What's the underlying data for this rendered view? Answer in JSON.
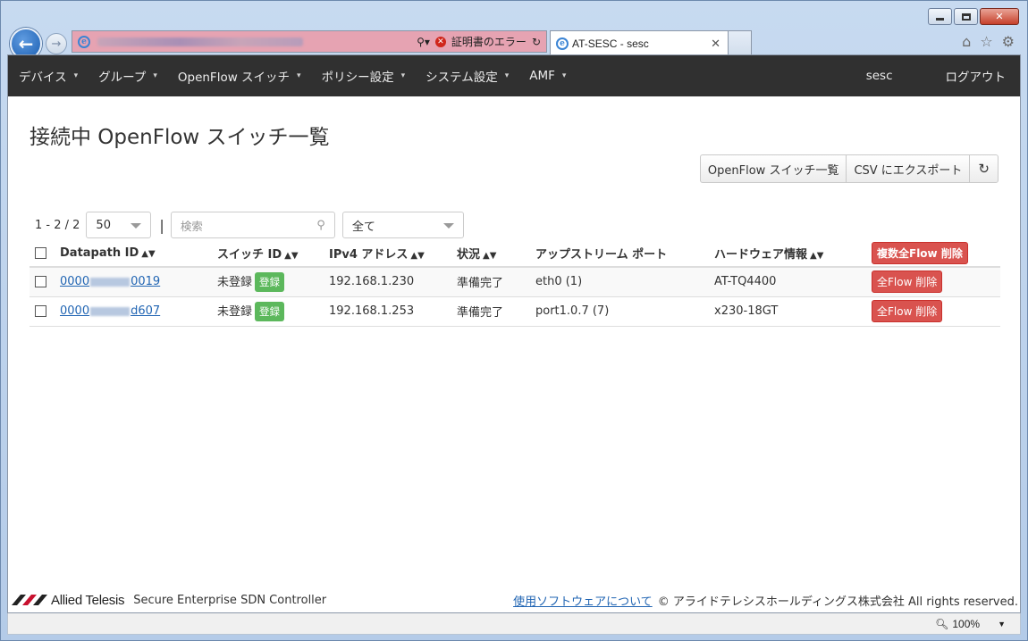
{
  "browser": {
    "tab_title": "AT-SESC - sesc",
    "cert_error": "証明書のエラー",
    "zoom": "100%"
  },
  "nav": {
    "items": [
      {
        "label": "デバイス"
      },
      {
        "label": "グループ"
      },
      {
        "label": "OpenFlow スイッチ"
      },
      {
        "label": "ポリシー設定"
      },
      {
        "label": "システム設定"
      },
      {
        "label": "AMF"
      }
    ],
    "user": "sesc",
    "logout": "ログアウト"
  },
  "page": {
    "title": "接続中 OpenFlow スイッチ一覧"
  },
  "actions": {
    "switch_list": "OpenFlow スイッチ一覧",
    "export_csv": "CSV にエクスポート"
  },
  "toolbar": {
    "pager": "1 - 2 / 2",
    "per_page": "50",
    "search_placeholder": "検索",
    "filter": "全て"
  },
  "table": {
    "headers": {
      "datapath_id": "Datapath ID",
      "switch_id": "スイッチ ID",
      "ipv4": "IPv4 アドレス",
      "status": "状況",
      "upstream_port": "アップストリーム ポート",
      "hardware": "ハードウェア情報",
      "bulk_delete": "複数全Flow 削除"
    },
    "rows": [
      {
        "dpid_prefix": "0000",
        "dpid_suffix": "0019",
        "switch_id": "未登録",
        "register": "登録",
        "ipv4": "192.168.1.230",
        "status": "準備完了",
        "port": "eth0 (1)",
        "hardware": "AT-TQ4400",
        "delete": "全Flow 削除"
      },
      {
        "dpid_prefix": "0000",
        "dpid_suffix": "d607",
        "switch_id": "未登録",
        "register": "登録",
        "ipv4": "192.168.1.253",
        "status": "準備完了",
        "port": "port1.0.7 (7)",
        "hardware": "x230-18GT",
        "delete": "全Flow 削除"
      }
    ]
  },
  "footer": {
    "brand": "Allied Telesis",
    "product": "Secure Enterprise SDN Controller",
    "about_link": "使用ソフトウェアについて",
    "copyright": "© アライドテレシスホールディングス株式会社 All rights reserved."
  },
  "colors": {
    "navbar": "#303030",
    "danger": "#d9534f",
    "success": "#5cb85c",
    "link": "#2165b3"
  }
}
